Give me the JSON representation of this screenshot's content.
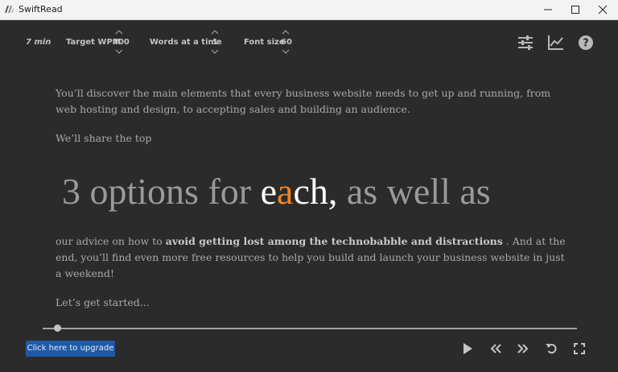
{
  "window": {
    "title": "SwiftRead"
  },
  "toolbar": {
    "time": "7 min",
    "target_wpm_label": "Target WPM",
    "target_wpm_value": "400",
    "words_label": "Words at a time",
    "words_value": "1",
    "font_label": "Font size",
    "font_value": "60",
    "icons": [
      "sliders-icon",
      "chart-icon",
      "help-icon"
    ]
  },
  "reader": {
    "para1": "You’ll discover the main elements that every business website needs to get up and running, from web hosting and design, to accepting sales and building an audience.",
    "para2": "We’ll share the top",
    "focus_before": "3 options for ",
    "focus_word_start": "e",
    "focus_word_pivot": "a",
    "focus_word_end": "ch,",
    "focus_after": " as well as",
    "para3_start": "our advice on how to ",
    "para3_bold": "avoid getting lost among the technobabble and distractions",
    "para3_end": " . And at the end, you’ll find even more free resources to help you build and launch your business website in just a weekend!",
    "para4": "Let’s get started..."
  },
  "progress": {
    "fraction": 0.02
  },
  "footer": {
    "upgrade_label": "Click here to upgrade",
    "controls": [
      "play-icon",
      "rewind-icon",
      "fast-forward-icon",
      "restart-icon",
      "fullscreen-icon"
    ]
  },
  "colors": {
    "background": "#2b2b2b",
    "accent": "#f5821f",
    "button": "#1e5aa8"
  }
}
